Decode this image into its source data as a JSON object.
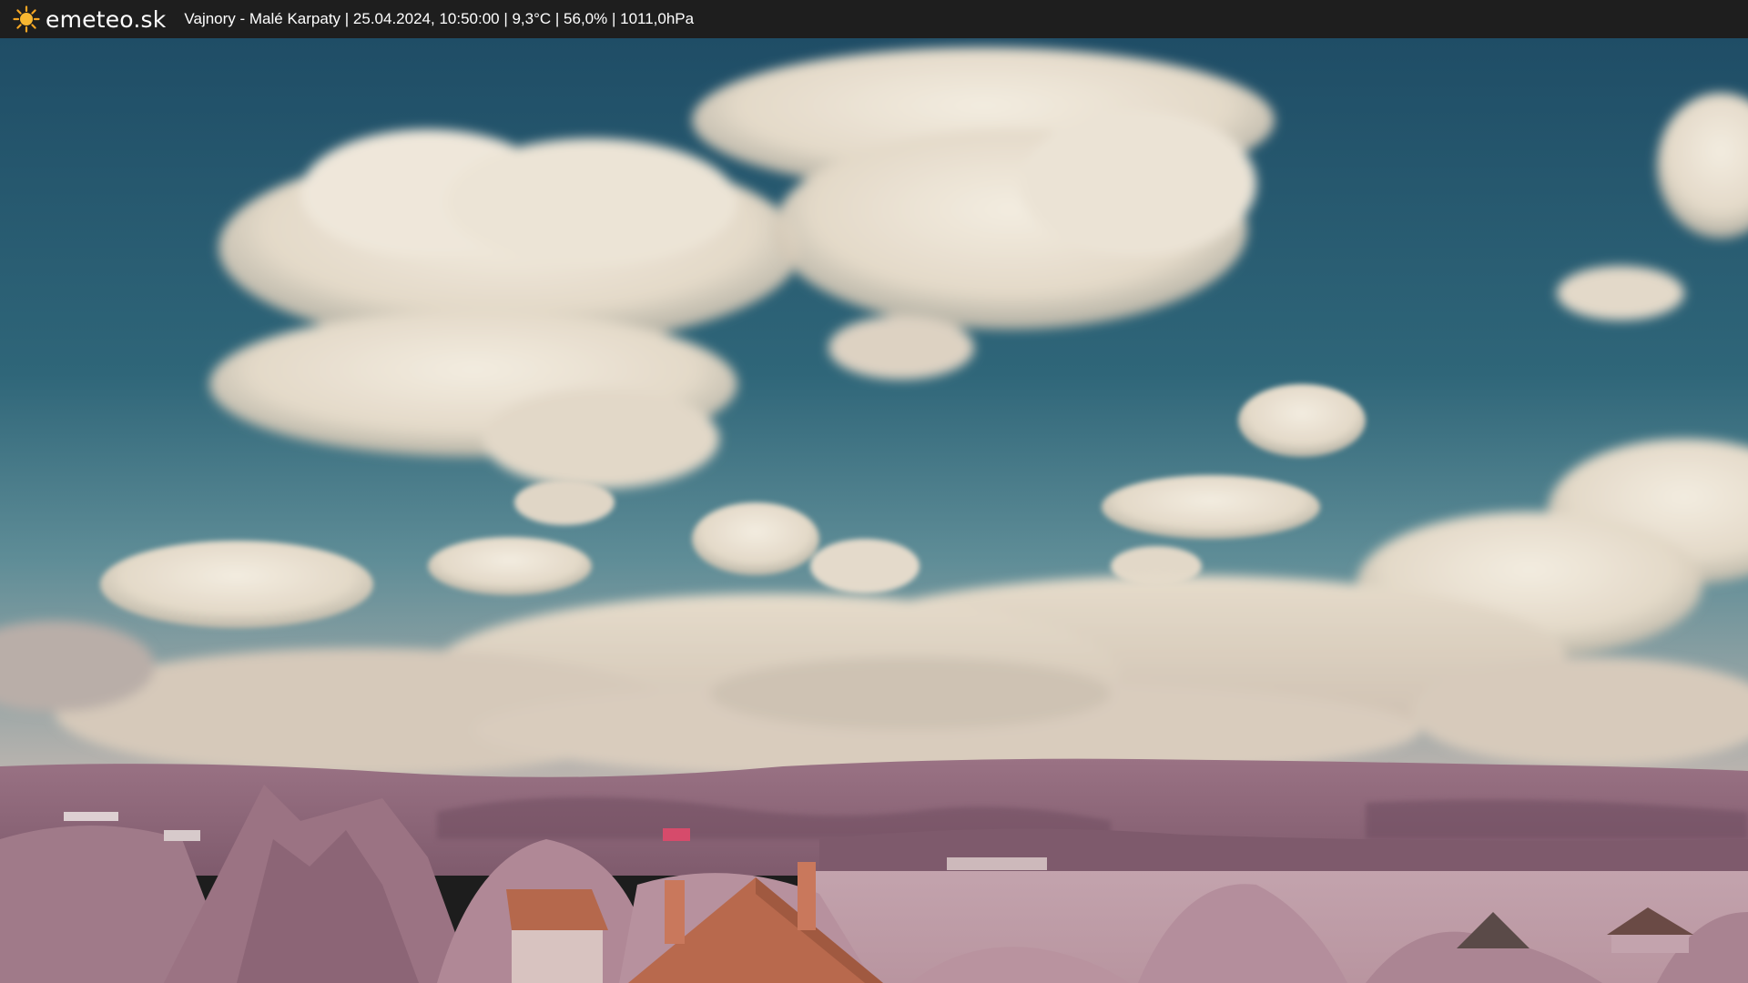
{
  "overlay": {
    "brand": "emeteo.sk",
    "caption": "Vajnory - Malé Karpaty | 25.04.2024, 10:50:00 | 9,3°C | 56,0% | 1011,0hPa",
    "icon": "sun-icon"
  },
  "colors": {
    "bar_background": "#1e1e1e",
    "sun": "#f5a623",
    "sky_top": "#1f4e67",
    "sky_mid": "#3d7487",
    "cloud": "#e9e1d3",
    "hills": "#8f6a7c",
    "foliage": "#b38a99",
    "roof": "#b5684c"
  }
}
